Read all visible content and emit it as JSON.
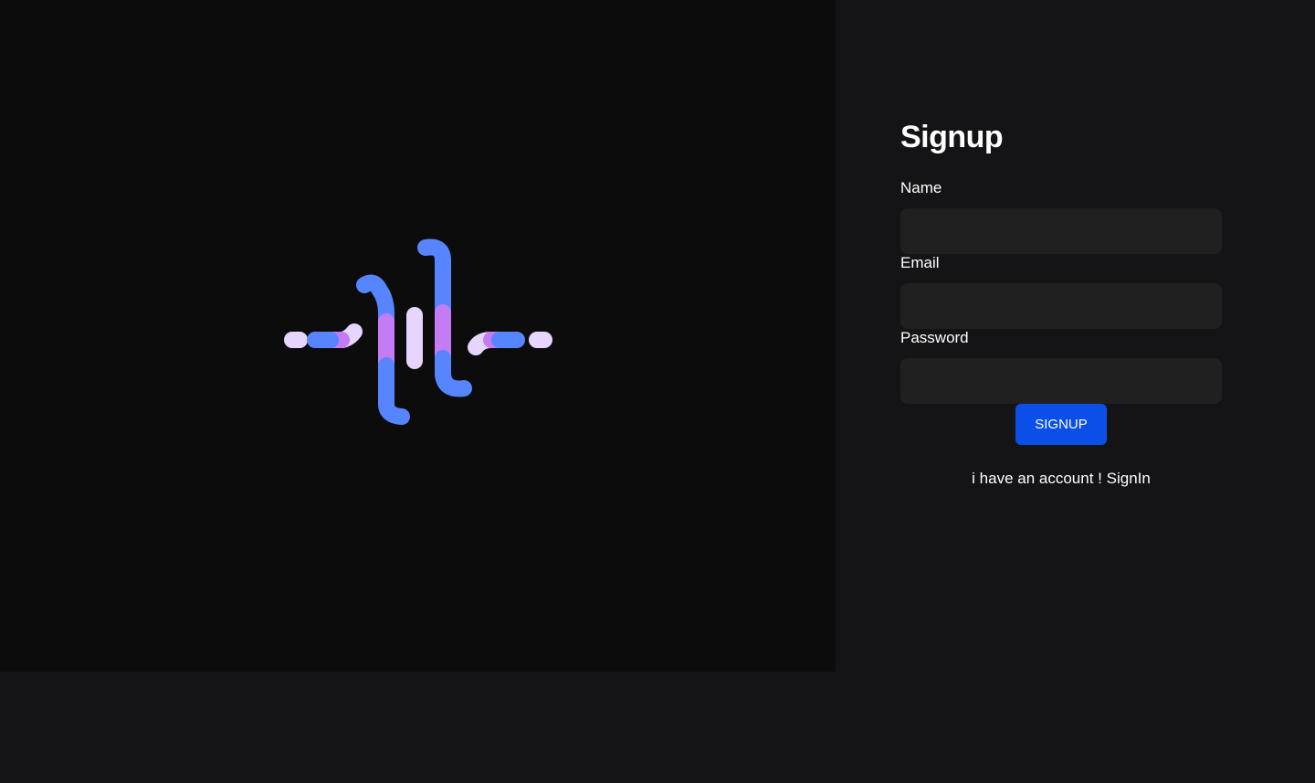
{
  "colors": {
    "page_bg": "#141416",
    "hero_bg": "#0c0c0c",
    "input_bg": "#202020",
    "accent": "#0b4fe8",
    "logo_blue": "#5784ff",
    "logo_purple": "#c47cf5",
    "logo_lavender": "#e6d6ff"
  },
  "hero": {
    "logo_icon": "abstract-logo-icon"
  },
  "form": {
    "title": "Signup",
    "fields": [
      {
        "label": "Name",
        "value": "",
        "placeholder": ""
      },
      {
        "label": "Email",
        "value": "",
        "placeholder": ""
      },
      {
        "label": "Password",
        "value": "",
        "placeholder": ""
      }
    ],
    "submit_label": "SIGNUP",
    "switch_text": "i have an account !",
    "switch_link": "SignIn"
  }
}
